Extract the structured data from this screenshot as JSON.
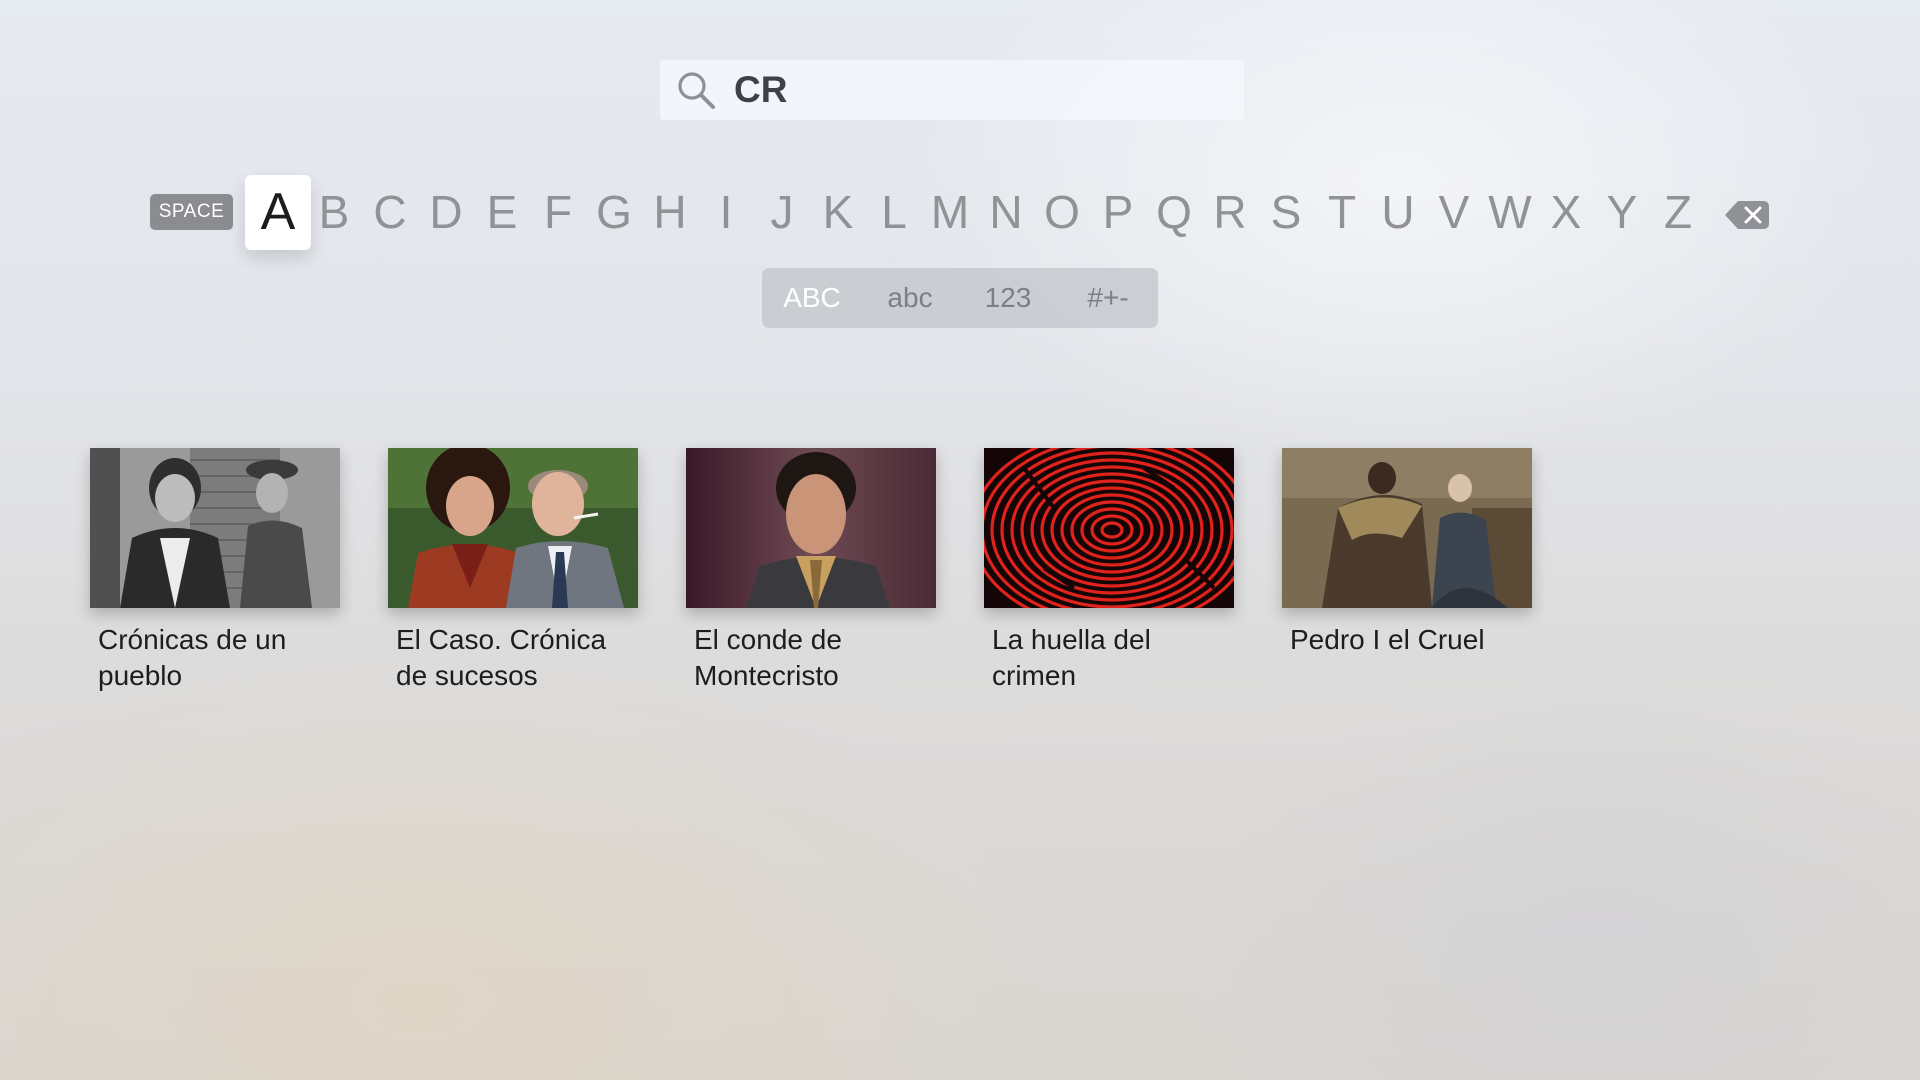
{
  "search": {
    "query": "CR"
  },
  "keyboard": {
    "space_label": "SPACE",
    "letters": [
      "A",
      "B",
      "C",
      "D",
      "E",
      "F",
      "G",
      "H",
      "I",
      "J",
      "K",
      "L",
      "M",
      "N",
      "O",
      "P",
      "Q",
      "R",
      "S",
      "T",
      "U",
      "V",
      "W",
      "X",
      "Y",
      "Z"
    ],
    "focused_letter": "A",
    "delete_icon": "delete-backspace-icon"
  },
  "case_modes": {
    "options": [
      "ABC",
      "abc",
      "123",
      "#+-"
    ],
    "selected": "ABC"
  },
  "results": [
    {
      "title_line1": "Crónicas de un",
      "title_line2": "pueblo"
    },
    {
      "title_line1": "El Caso. Crónica",
      "title_line2": "de sucesos"
    },
    {
      "title_line1": "El conde de",
      "title_line2": "Montecristo"
    },
    {
      "title_line1": "La huella del",
      "title_line2": "crimen"
    },
    {
      "title_line1": "Pedro I el Cruel",
      "title_line2": ""
    }
  ],
  "colors": {
    "accent_selected_text": "#ffffff",
    "letter_inactive": "#909296",
    "fingerprint_red": "#e0221c"
  }
}
